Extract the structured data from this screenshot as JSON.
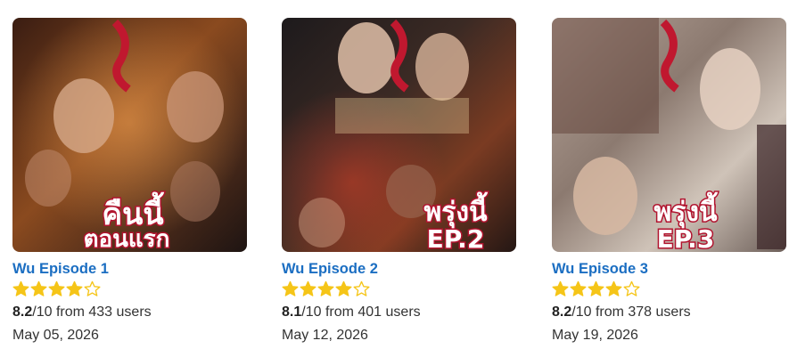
{
  "episodes": [
    {
      "title": "Wu Episode 1",
      "rating_value": "8.2",
      "rating_rest": "/10 from 433 users",
      "stars_filled": 4,
      "stars_total": 5,
      "date": "May 05, 2026",
      "poster": {
        "line1": "คืนนี้",
        "line2": "ตอนแรก",
        "logo": "อู"
      }
    },
    {
      "title": "Wu Episode 2",
      "rating_value": "8.1",
      "rating_rest": "/10 from 401 users",
      "stars_filled": 4,
      "stars_total": 5,
      "date": "May 12, 2026",
      "poster": {
        "line1": "พรุ่งนี้",
        "line2": "EP.2",
        "logo": "อู"
      }
    },
    {
      "title": "Wu Episode 3",
      "rating_value": "8.2",
      "rating_rest": "/10 from 378 users",
      "stars_filled": 4,
      "stars_total": 5,
      "date": "May 19, 2026",
      "poster": {
        "line1": "พรุ่งนี้",
        "line2": "EP.3",
        "logo": "อู"
      }
    }
  ],
  "colors": {
    "link": "#1b6ec2",
    "star_fill": "#f5c518",
    "star_outline": "#f5c518",
    "poster_accent": "#b1132e"
  },
  "icons": {
    "star": "star-icon",
    "star_empty": "star-outline-icon"
  }
}
